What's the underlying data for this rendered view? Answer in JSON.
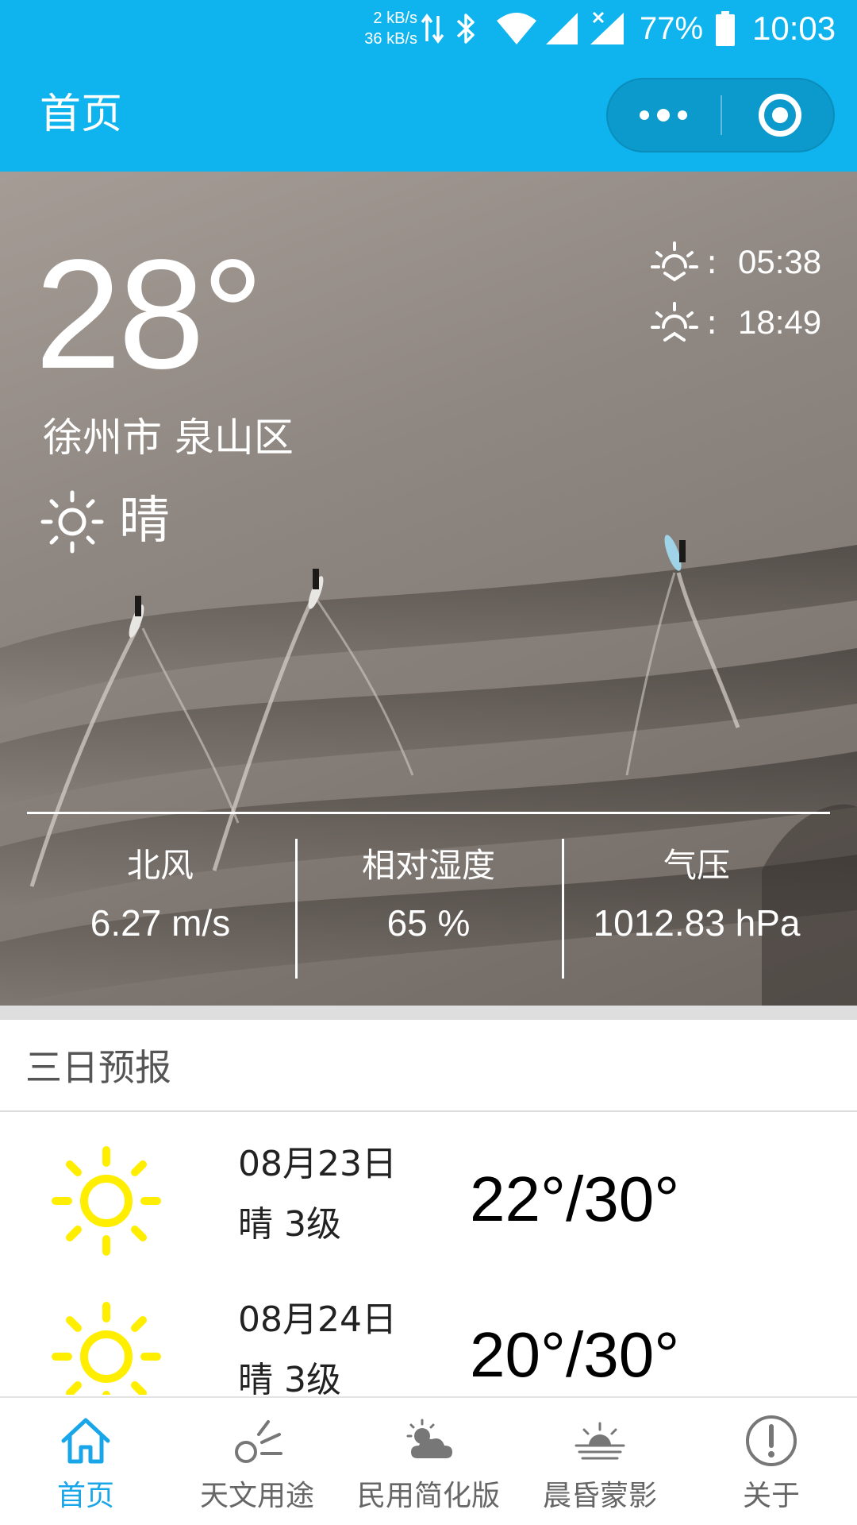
{
  "status_bar": {
    "up_speed": "2 kB/s",
    "down_speed": "36 kB/s",
    "battery": "77%",
    "time": "10:03",
    "icons": [
      "data-arrows-icon",
      "bluetooth-icon",
      "wifi-icon",
      "signal-icon",
      "signal-no-sim-icon",
      "battery-icon"
    ]
  },
  "nav": {
    "title": "首页",
    "menu_icon": "more-dots-icon",
    "close_icon": "target-close-icon",
    "color": "#0fb4ee"
  },
  "current": {
    "temperature": "28°",
    "location": "徐州市 泉山区",
    "condition_icon": "sun-icon",
    "condition": "晴",
    "sunrise": {
      "icon": "sunrise-icon",
      "colon": ":",
      "time": "05:38"
    },
    "sunset": {
      "icon": "sunset-icon",
      "colon": ":",
      "time": "18:49"
    }
  },
  "stats": [
    {
      "label": "北风",
      "value": "6.27 m/s"
    },
    {
      "label": "相对湿度",
      "value": "65 %"
    },
    {
      "label": "气压",
      "value": "1012.83 hPa"
    }
  ],
  "forecast": {
    "title": "三日预报",
    "icon_color": "#ffee00",
    "days": [
      {
        "icon": "sun-icon",
        "date": "08月23日",
        "desc": "晴 3级",
        "range": "22°/30°"
      },
      {
        "icon": "sun-icon",
        "date": "08月24日",
        "desc": "晴 3级",
        "range": "20°/30°"
      }
    ]
  },
  "tabs": [
    {
      "label": "首页",
      "icon": "home-icon",
      "active": true
    },
    {
      "label": "天文用途",
      "icon": "telescope-icon",
      "active": false
    },
    {
      "label": "民用简化版",
      "icon": "sun-cloud-icon",
      "active": false
    },
    {
      "label": "晨昏蒙影",
      "icon": "twilight-icon",
      "active": false
    },
    {
      "label": "关于",
      "icon": "info-icon",
      "active": false
    }
  ],
  "accent_color": "#18a6e8"
}
